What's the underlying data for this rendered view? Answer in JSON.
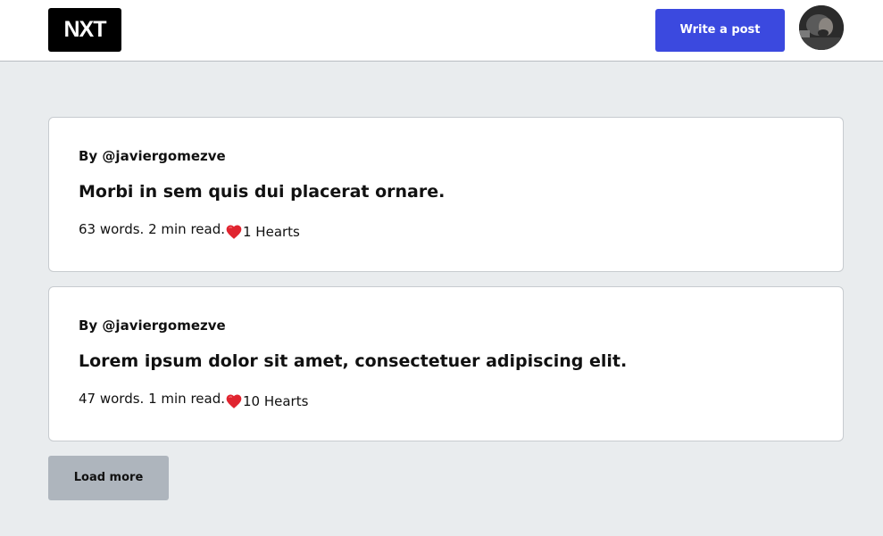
{
  "header": {
    "logo_text": "NXT",
    "write_button_label": "Write a post"
  },
  "posts": [
    {
      "author": "By @javiergomezve",
      "title": "Morbi in sem quis dui placerat ornare.",
      "read_info": "63 words. 2 min read.",
      "hearts": "1 Hearts"
    },
    {
      "author": "By @javiergomezve",
      "title": "Lorem ipsum dolor sit amet, consectetuer adipiscing elit.",
      "read_info": "47 words. 1 min read.",
      "hearts": "10 Hearts"
    }
  ],
  "load_more_label": "Load more",
  "colors": {
    "primary_button": "#3b49df",
    "heart": "#e0242f",
    "page_background": "#e9ecee",
    "load_more_button": "#aeb5bd"
  },
  "icons": {
    "heart": "heart-icon",
    "avatar": "user-avatar"
  }
}
